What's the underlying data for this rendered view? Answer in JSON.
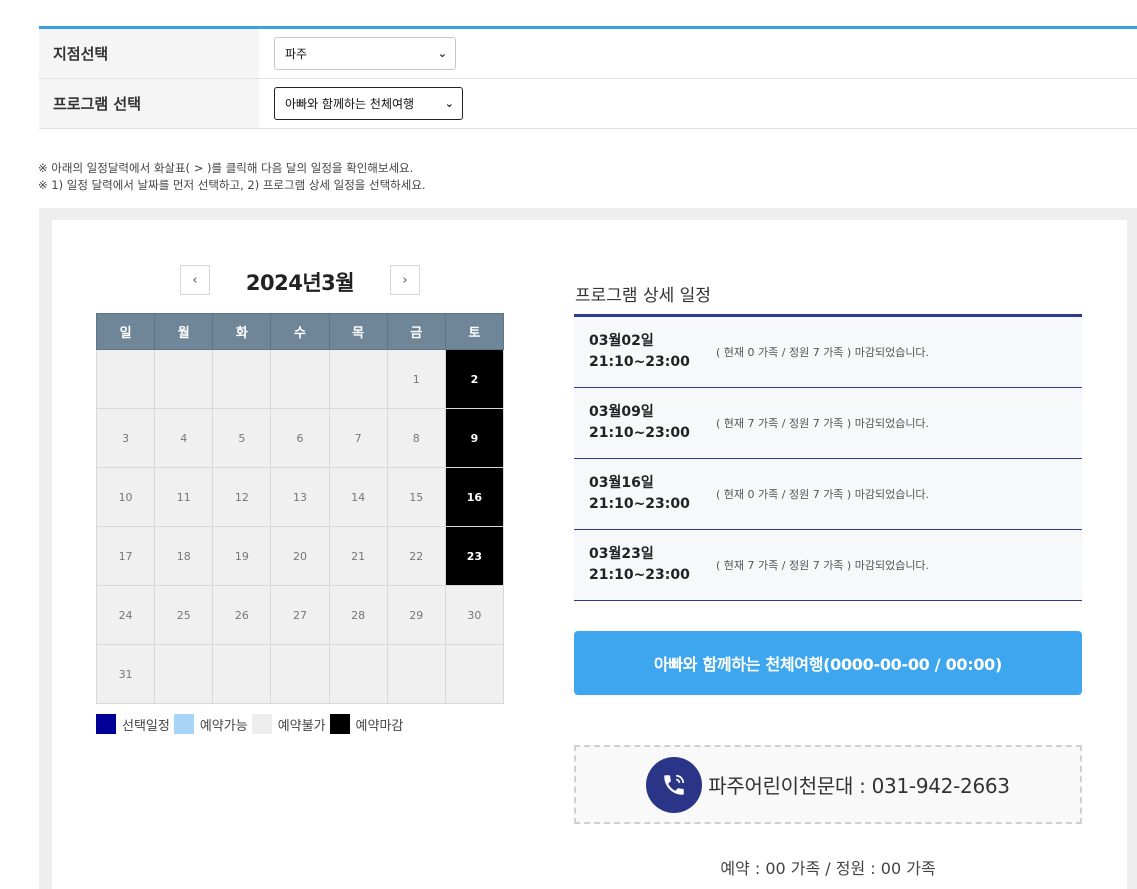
{
  "filters": {
    "branch_label": "지점선택",
    "branch_value": "파주",
    "program_label": "프로그램 선택",
    "program_value": "아빠와 함께하는 천체여행"
  },
  "notes": {
    "line1": "※ 아래의 일정달력에서 화살표( > )를 클릭해 다음 달의 일정을 확인해보세요.",
    "line2": "※ 1) 일정 달력에서 날짜를 먼저 선택하고, 2) 프로그램 상세 일정을 선택하세요."
  },
  "calendar": {
    "title": "2024년3월",
    "prev_icon": "‹",
    "next_icon": "›",
    "weekdays": [
      "일",
      "월",
      "화",
      "수",
      "목",
      "금",
      "토"
    ],
    "weeks": [
      [
        "",
        "",
        "",
        "",
        "",
        "1",
        "2"
      ],
      [
        "3",
        "4",
        "5",
        "6",
        "7",
        "8",
        "9"
      ],
      [
        "10",
        "11",
        "12",
        "13",
        "14",
        "15",
        "16"
      ],
      [
        "17",
        "18",
        "19",
        "20",
        "21",
        "22",
        "23"
      ],
      [
        "24",
        "25",
        "26",
        "27",
        "28",
        "29",
        "30"
      ],
      [
        "31",
        "",
        "",
        "",
        "",
        "",
        ""
      ]
    ],
    "closed_days": [
      "2",
      "9",
      "16",
      "23"
    ]
  },
  "legend": [
    {
      "label": "선택일정",
      "color": "#000099"
    },
    {
      "label": "예약가능",
      "color": "#a8d4f7"
    },
    {
      "label": "예약불가",
      "color": "#eeeeee"
    },
    {
      "label": "예약마감",
      "color": "#000000"
    }
  ],
  "schedule": {
    "title": "프로그램 상세 일정",
    "items": [
      {
        "date": "03월02일",
        "time": "21:10~23:00",
        "status": "( 현재 0 가족 / 정원 7 가족 ) 마감되었습니다."
      },
      {
        "date": "03월09일",
        "time": "21:10~23:00",
        "status": "( 현재 7 가족 / 정원 7 가족 ) 마감되었습니다."
      },
      {
        "date": "03월16일",
        "time": "21:10~23:00",
        "status": "( 현재 0 가족 / 정원 7 가족 ) 마감되었습니다."
      },
      {
        "date": "03월23일",
        "time": "21:10~23:00",
        "status": "( 현재 7 가족 / 정원 7 가족 ) 마감되었습니다."
      }
    ]
  },
  "main_button": "아빠와 함께하는 천체여행(0000-00-00 / 00:00)",
  "contact": {
    "icon": "phone-icon",
    "text": "파주어린이천문대 : 031-942-2663"
  },
  "count_text": "예약 : 00 가족 / 정원 : 00 가족",
  "colors": {
    "accent": "#3ea6ee",
    "navy": "#2e3a8c",
    "header_gray": "#6e8697"
  }
}
